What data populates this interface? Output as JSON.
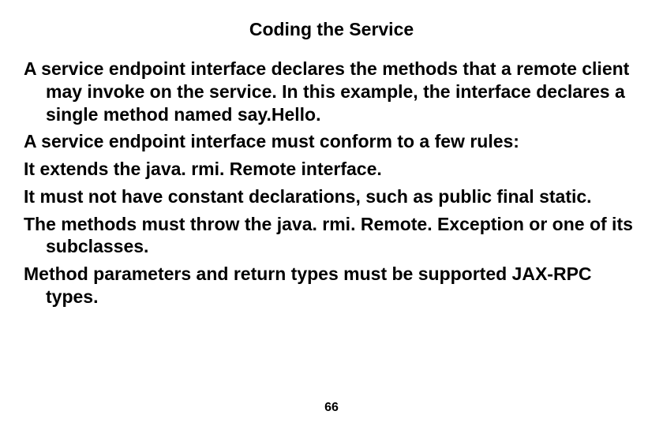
{
  "title": "Coding the Service",
  "paragraphs": [
    "A service endpoint interface declares the methods that a remote client may invoke on the service. In this example, the interface declares a single method named say.Hello.",
    "A service endpoint interface must conform to a few rules:",
    "It extends the java. rmi. Remote interface.",
    "It must not have constant declarations, such as public final static.",
    "The methods must throw the java. rmi. Remote. Exception or one of its subclasses.",
    "Method parameters and return types must be supported JAX-RPC types."
  ],
  "page_number": "66"
}
